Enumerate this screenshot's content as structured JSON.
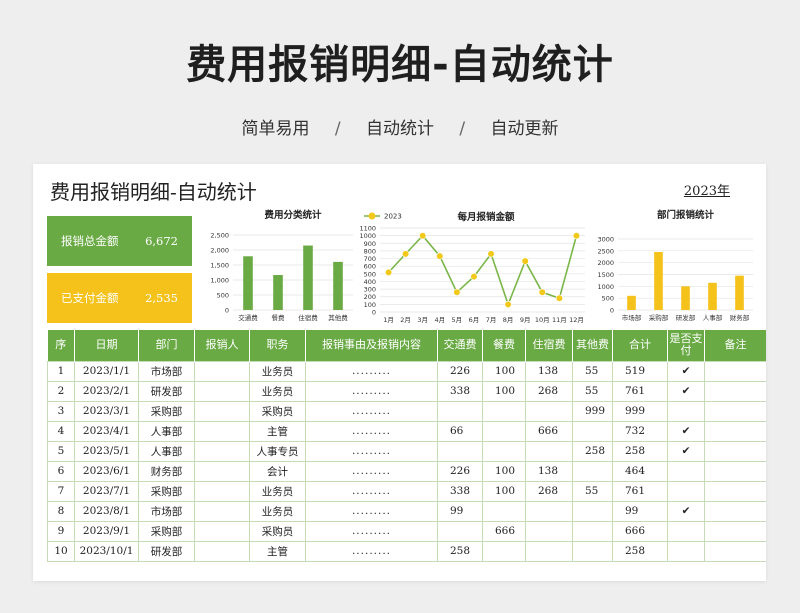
{
  "header": {
    "title": "费用报销明细-自动统计",
    "features": [
      "简单易用",
      "自动统计",
      "自动更新"
    ],
    "separator": "/"
  },
  "sheet": {
    "title": "费用报销明细-自动统计",
    "year": "2023年"
  },
  "kpis": {
    "total": {
      "label": "报销总金额",
      "value": "6,672"
    },
    "paid": {
      "label": "已支付金额",
      "value": "2,535"
    }
  },
  "colors": {
    "green": "#6aaa45",
    "yellow": "#f5c21b",
    "line": "#7ab648",
    "marker": "#f2c81b"
  },
  "chart_data": [
    {
      "type": "bar",
      "title": "费用分类统计",
      "categories": [
        "交通费",
        "餐费",
        "住宿费",
        "其他费"
      ],
      "values": [
        1791,
        1166,
        2149,
        1604
      ],
      "y_ticks": [
        "0",
        "500",
        "1,000",
        "1,500",
        "2,000",
        "2,500"
      ],
      "ylim": [
        0,
        2500
      ],
      "grid": true,
      "color": "#6aaa45"
    },
    {
      "type": "line",
      "title": "每月报销金额",
      "legend": "2023",
      "legend_position": "top-left",
      "categories": [
        "1月",
        "2月",
        "3月",
        "4月",
        "5月",
        "6月",
        "7月",
        "8月",
        "9月",
        "10月",
        "11月",
        "12月"
      ],
      "values": [
        519,
        761,
        999,
        732,
        258,
        464,
        761,
        99,
        666,
        258,
        180,
        999
      ],
      "y_ticks": [
        "0",
        "100",
        "200",
        "300",
        "400",
        "500",
        "600",
        "700",
        "800",
        "900",
        "1000",
        "1100"
      ],
      "ylim": [
        0,
        1100
      ],
      "grid": true,
      "color": "#7ab648",
      "marker_color": "#f2c81b"
    },
    {
      "type": "bar",
      "title": "部门报销统计",
      "categories": [
        "市场部",
        "采购部",
        "研发部",
        "人事部",
        "财务部"
      ],
      "values": [
        600,
        2450,
        1000,
        1150,
        1450
      ],
      "y_ticks": [
        "0",
        "500",
        "1000",
        "1500",
        "2000",
        "2500",
        "3000"
      ],
      "ylim": [
        0,
        3000
      ],
      "grid": true,
      "color": "#f5c21b"
    }
  ],
  "table": {
    "headers": [
      "序",
      "日期",
      "部门",
      "报销人",
      "职务",
      "报销事由及报销内容",
      "交通费",
      "餐费",
      "住宿费",
      "其他费",
      "合计",
      "是否支付",
      "备注"
    ],
    "rows": [
      [
        "1",
        "2023/1/1",
        "市场部",
        "",
        "业务员",
        ".........",
        "226",
        "100",
        "138",
        "55",
        "519",
        "✔",
        ""
      ],
      [
        "2",
        "2023/2/1",
        "研发部",
        "",
        "业务员",
        ".........",
        "338",
        "100",
        "268",
        "55",
        "761",
        "✔",
        ""
      ],
      [
        "3",
        "2023/3/1",
        "采购部",
        "",
        "采购员",
        ".........",
        "",
        "",
        "",
        "999",
        "999",
        "",
        ""
      ],
      [
        "4",
        "2023/4/1",
        "人事部",
        "",
        "主管",
        ".........",
        "66",
        "",
        "666",
        "",
        "732",
        "✔",
        ""
      ],
      [
        "5",
        "2023/5/1",
        "人事部",
        "",
        "人事专员",
        ".........",
        "",
        "",
        "",
        "258",
        "258",
        "✔",
        ""
      ],
      [
        "6",
        "2023/6/1",
        "财务部",
        "",
        "会计",
        ".........",
        "226",
        "100",
        "138",
        "",
        "464",
        "",
        ""
      ],
      [
        "7",
        "2023/7/1",
        "采购部",
        "",
        "业务员",
        ".........",
        "338",
        "100",
        "268",
        "55",
        "761",
        "",
        ""
      ],
      [
        "8",
        "2023/8/1",
        "市场部",
        "",
        "业务员",
        ".........",
        "99",
        "",
        "",
        "",
        "99",
        "✔",
        ""
      ],
      [
        "9",
        "2023/9/1",
        "采购部",
        "",
        "采购员",
        ".........",
        "",
        "666",
        "",
        "",
        "666",
        "",
        ""
      ],
      [
        "10",
        "2023/10/1",
        "研发部",
        "",
        "主管",
        ".........",
        "258",
        "",
        "",
        "",
        "258",
        "",
        ""
      ]
    ]
  }
}
